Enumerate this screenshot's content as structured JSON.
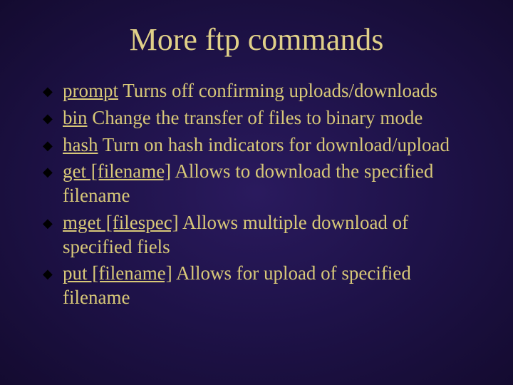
{
  "title": "More ftp commands",
  "items": [
    {
      "cmd": "prompt",
      "desc": " Turns off confirming uploads/downloads"
    },
    {
      "cmd": "bin",
      "desc": " Change the transfer of files to binary mode"
    },
    {
      "cmd": "hash",
      "desc": " Turn on hash indicators for download/upload"
    },
    {
      "cmd": "get [filename]",
      "desc": " Allows to download the specified filename"
    },
    {
      "cmd": "mget [filespec]",
      "desc": " Allows multiple download of specified fiels"
    },
    {
      "cmd": "put [filename]",
      "desc": " Allows for upload of specified filename"
    }
  ]
}
